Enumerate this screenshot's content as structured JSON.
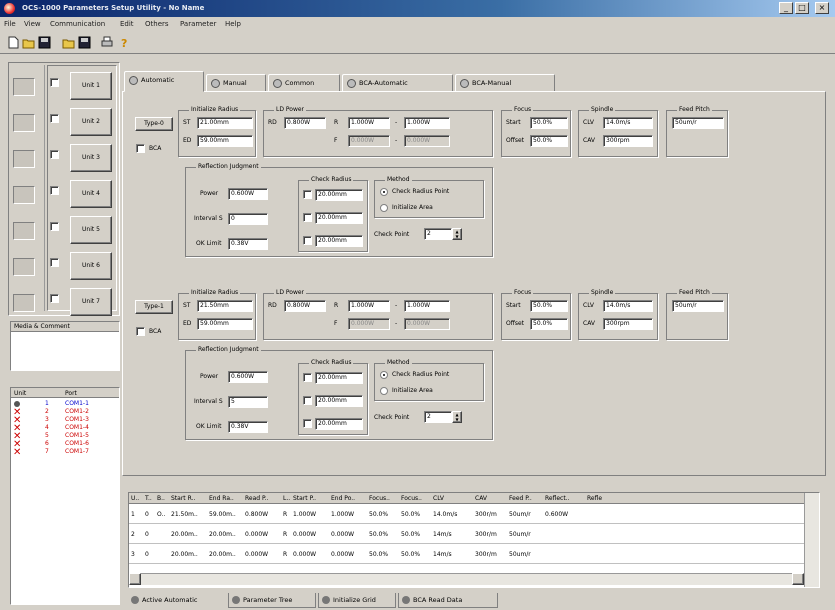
{
  "window": {
    "title": "OCS-1000 Parameters Setup Utility - No Name",
    "minimize": "_",
    "maximize": "□",
    "close": "×"
  },
  "menu": [
    "File",
    "View",
    "Communication",
    "Edit",
    "Others",
    "Parameter",
    "Help"
  ],
  "toolbar": [
    "new-icon",
    "open-icon",
    "save-icon",
    "open-disk-icon",
    "save-disk-icon",
    "print-icon",
    "help-icon"
  ],
  "units": [
    "Unit 1",
    "Unit 2",
    "Unit 3",
    "Unit 4",
    "Unit 5",
    "Unit 6",
    "Unit 7"
  ],
  "media_label": "Media & Comment",
  "unit_table": {
    "headers": [
      "Unit",
      "Port"
    ],
    "rows": [
      {
        "unit": "1",
        "port": "COM1-1",
        "ok": true
      },
      {
        "unit": "2",
        "port": "COM1-2",
        "ok": false
      },
      {
        "unit": "3",
        "port": "COM1-3",
        "ok": false
      },
      {
        "unit": "4",
        "port": "COM1-4",
        "ok": false
      },
      {
        "unit": "5",
        "port": "COM1-5",
        "ok": false
      },
      {
        "unit": "6",
        "port": "COM1-6",
        "ok": false
      },
      {
        "unit": "7",
        "port": "COM1-7",
        "ok": false
      }
    ]
  },
  "colors": {
    "ok": "#0000cc",
    "fail": "#cc0000",
    "title_start": "#0a246a",
    "title_end": "#a6caf0"
  },
  "tabs": [
    "Automatic",
    "Manual",
    "Common",
    "BCA-Automatic",
    "BCA-Manual"
  ],
  "blocks": [
    {
      "type_btn": "Type-0",
      "bca": "BCA",
      "init_radius": {
        "title": "Initialize Radius",
        "st_label": "ST",
        "st": "21.00mm",
        "ed_label": "ED",
        "ed": "59.00mm"
      },
      "ld_power": {
        "title": "LD Power",
        "rd_label": "RD",
        "rd": "0.800W",
        "r_label": "R",
        "r": "1.000W",
        "r_max": "1.000W",
        "f_label": "F",
        "f": "0.000W",
        "f_max": "0.000W"
      },
      "focus": {
        "title": "Focus",
        "start_label": "Start",
        "start": "50.0%",
        "offset_label": "Offset",
        "offset": "50.0%"
      },
      "spindle": {
        "title": "Spindle",
        "clv_label": "CLV",
        "clv": "14.0m/s",
        "cav_label": "CAV",
        "cav": "300rpm"
      },
      "feed_pitch": {
        "title": "Feed Pitch",
        "value": "50um/r"
      },
      "reflection": {
        "title": "Reflection Judgment",
        "power_label": "Power",
        "power": "0.600W",
        "interval_label": "Interval S",
        "interval": "0",
        "ok_label": "OK Limit",
        "ok": "0.38V",
        "check_title": "Check Radius",
        "radii": [
          "20.00mm",
          "20.00mm",
          "20.00mm"
        ],
        "method_title": "Method",
        "method_opts": [
          "Check Radius Point",
          "Initialize Area"
        ],
        "check_point_label": "Check Point",
        "check_point": "2"
      }
    },
    {
      "type_btn": "Type-1",
      "bca": "BCA",
      "init_radius": {
        "title": "Initialize Radius",
        "st_label": "ST",
        "st": "21.50mm",
        "ed_label": "ED",
        "ed": "59.00mm"
      },
      "ld_power": {
        "title": "LD Power",
        "rd_label": "RD",
        "rd": "0.800W",
        "r_label": "R",
        "r": "1.000W",
        "r_max": "1.000W",
        "f_label": "F",
        "f": "0.000W",
        "f_max": "0.000W"
      },
      "focus": {
        "title": "Focus",
        "start_label": "Start",
        "start": "50.0%",
        "offset_label": "Offset",
        "offset": "50.0%"
      },
      "spindle": {
        "title": "Spindle",
        "clv_label": "CLV",
        "clv": "14.0m/s",
        "cav_label": "CAV",
        "cav": "300rpm"
      },
      "feed_pitch": {
        "title": "Feed Pitch",
        "value": "50um/r"
      },
      "reflection": {
        "title": "Reflection Judgment",
        "power_label": "Power",
        "power": "0.600W",
        "interval_label": "Interval S",
        "interval": "5",
        "ok_label": "OK Limit",
        "ok": "0.38V",
        "check_title": "Check Radius",
        "radii": [
          "20.00mm",
          "20.00mm",
          "20.00mm"
        ],
        "method_title": "Method",
        "method_opts": [
          "Check Radius Point",
          "Initialize Area"
        ],
        "check_point_label": "Check Point",
        "check_point": "2"
      }
    }
  ],
  "grid": {
    "headers": [
      "U..",
      "T..",
      "B..",
      "Start R..",
      "End Ra..",
      "Read P..",
      "L..",
      "Start P..",
      "End Po..",
      "Focus..",
      "Focus..",
      "CLV",
      "CAV",
      "Feed P..",
      "Reflect..",
      "Refle"
    ],
    "rows": [
      [
        "1",
        "0",
        "O..",
        "21.50m..",
        "59.00m..",
        "0.800W",
        "R",
        "1.000W",
        "1.000W",
        "50.0%",
        "50.0%",
        "14.0m/s",
        "300r/m",
        "50um/r",
        "0.600W",
        ""
      ],
      [
        "2",
        "0",
        "",
        "20.00m..",
        "20.00m..",
        "0.000W",
        "R",
        "0.000W",
        "0.000W",
        "50.0%",
        "50.0%",
        "14m/s",
        "300r/m",
        "50um/r",
        "",
        ""
      ],
      [
        "3",
        "0",
        "",
        "20.00m..",
        "20.00m..",
        "0.000W",
        "R",
        "0.000W",
        "0.000W",
        "50.0%",
        "50.0%",
        "14m/s",
        "300r/m",
        "50um/r",
        "",
        ""
      ]
    ]
  },
  "bottom_tabs": [
    "Active Automatic",
    "Parameter Tree",
    "Initialize Grid",
    "BCA Read Data"
  ]
}
